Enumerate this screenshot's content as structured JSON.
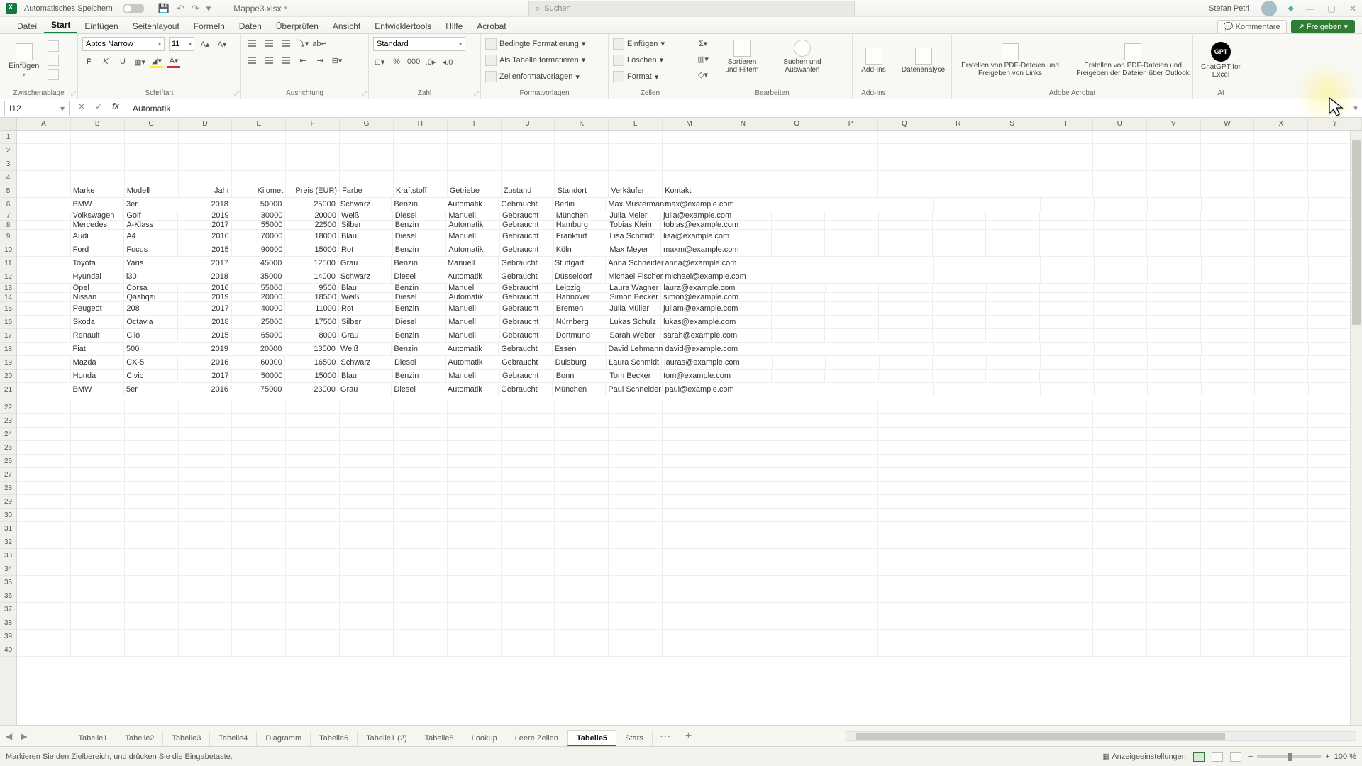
{
  "title": {
    "autosave": "Automatisches Speichern",
    "filename": "Mappe3.xlsx",
    "search_ph": "Suchen",
    "user": "Stefan Petri"
  },
  "ribbon_tabs": [
    "Datei",
    "Start",
    "Einfügen",
    "Seitenlayout",
    "Formeln",
    "Daten",
    "Überprüfen",
    "Ansicht",
    "Entwicklertools",
    "Hilfe",
    "Acrobat"
  ],
  "ribbon_right": {
    "kommentare": "Kommentare",
    "freigeben": "Freigeben"
  },
  "grp": {
    "einfuegen": "Einfügen",
    "zwischen": "Zwischenablage",
    "font": "Aptos Narrow",
    "size": "11",
    "schriftart": "Schriftart",
    "ausrichtung": "Ausrichtung",
    "numfmt": "Standard",
    "zahl": "Zahl",
    "bed": "Bedingte Formatierung",
    "als": "Als Tabelle formatieren",
    "zell": "Zellenformatvorlagen",
    "formatv": "Formatvorlagen",
    "ins": "Einfügen",
    "del": "Löschen",
    "fmt": "Format",
    "zellen": "Zellen",
    "sort": "Sortieren und Filtern",
    "such": "Suchen und Auswählen",
    "bearb": "Bearbeiten",
    "addins": "Add-Ins",
    "addins_g": "Add-Ins",
    "daten": "Datenanalyse",
    "pdf1": "Erstellen von PDF-Dateien und Freigeben von Links",
    "pdf2": "Erstellen von PDF-Dateien und Freigeben der Dateien über Outlook",
    "adobe": "Adobe Acrobat",
    "gpt": "ChatGPT for Excel",
    "ai": "AI"
  },
  "namebox": "I12",
  "formula": "Automatik",
  "cols": [
    "A",
    "B",
    "C",
    "D",
    "E",
    "F",
    "G",
    "H",
    "I",
    "J",
    "K",
    "L",
    "M",
    "N",
    "O",
    "P",
    "Q",
    "R",
    "S",
    "T",
    "U",
    "V",
    "W",
    "X",
    "Y"
  ],
  "row_layout": [
    {
      "n": "1"
    },
    {
      "n": "2"
    },
    {
      "n": "3"
    },
    {
      "n": "4"
    },
    {
      "n": "5",
      "d": 0
    },
    {
      "n": "6",
      "d": 1
    },
    {
      "n": "7",
      "d": 2,
      "squish": true
    },
    {
      "n": "8",
      "d": 3,
      "squish": true
    },
    {
      "n": "9",
      "d": 4
    },
    {
      "n": "10",
      "d": 5
    },
    {
      "n": "11",
      "d": 6
    },
    {
      "n": "12",
      "d": 7
    },
    {
      "n": "13",
      "d": 8,
      "squish": true
    },
    {
      "n": "14",
      "d": 9,
      "squish": true
    },
    {
      "n": "15",
      "d": 10
    },
    {
      "n": "16",
      "d": 11
    },
    {
      "n": "17",
      "d": 12
    },
    {
      "n": "18",
      "d": 13
    },
    {
      "n": "19",
      "d": 14
    },
    {
      "n": "20",
      "d": 15
    },
    {
      "n": "21",
      "d": 16,
      "gap": true
    },
    {
      "n": "22"
    },
    {
      "n": "23"
    },
    {
      "n": "24"
    },
    {
      "n": "25"
    },
    {
      "n": "26"
    },
    {
      "n": "27"
    },
    {
      "n": "28"
    },
    {
      "n": "29"
    },
    {
      "n": "30"
    },
    {
      "n": "31"
    },
    {
      "n": "32"
    },
    {
      "n": "33"
    },
    {
      "n": "34"
    },
    {
      "n": "35"
    },
    {
      "n": "36"
    },
    {
      "n": "37"
    },
    {
      "n": "38"
    },
    {
      "n": "39"
    },
    {
      "n": "40"
    }
  ],
  "data_rows": [
    [
      "Marke",
      "Modell",
      "Jahr",
      "Kilomet",
      "Preis (EUR)",
      "Farbe",
      "Kraftstoff",
      "Getriebe",
      "Zustand",
      "Standort",
      "Verkäufer",
      "Kontakt"
    ],
    [
      "BMW",
      "3er",
      "2018",
      "50000",
      "25000",
      "Schwarz",
      "Benzin",
      "Automatik",
      "Gebraucht",
      "Berlin",
      "Max Mustermann",
      "max@example.com"
    ],
    [
      "Volkswagen",
      "Golf",
      "2019",
      "30000",
      "20000",
      "Weiß",
      "Diesel",
      "Manuell",
      "Gebraucht",
      "München",
      "Julia Meier",
      "julia@example.com"
    ],
    [
      "Mercedes",
      "A-Klass",
      "2017",
      "55000",
      "22500",
      "Silber",
      "Benzin",
      "Automatik",
      "Gebraucht",
      "Hamburg",
      "Tobias Klein",
      "tobias@example.com"
    ],
    [
      "Audi",
      "A4",
      "2016",
      "70000",
      "18000",
      "Blau",
      "Diesel",
      "Manuell",
      "Gebraucht",
      "Frankfurt",
      "Lisa Schmidt",
      "lisa@example.com"
    ],
    [
      "Ford",
      "Focus",
      "2015",
      "90000",
      "15000",
      "Rot",
      "Benzin",
      "Automatik",
      "Gebraucht",
      "Köln",
      "Max Meyer",
      "maxm@example.com"
    ],
    [
      "Toyota",
      "Yaris",
      "2017",
      "45000",
      "12500",
      "Grau",
      "Benzin",
      "Manuell",
      "Gebraucht",
      "Stuttgart",
      "Anna Schneider",
      "anna@example.com"
    ],
    [
      "Hyundai",
      "i30",
      "2018",
      "35000",
      "14000",
      "Schwarz",
      "Diesel",
      "Automatik",
      "Gebraucht",
      "Düsseldorf",
      "Michael Fischer",
      "michael@example.com"
    ],
    [
      "Opel",
      "Corsa",
      "2016",
      "55000",
      "9500",
      "Blau",
      "Benzin",
      "Manuell",
      "Gebraucht",
      "Leipzig",
      "Laura Wagner",
      "laura@example.com"
    ],
    [
      "Nissan",
      "Qashqai",
      "2019",
      "20000",
      "18500",
      "Weiß",
      "Diesel",
      "Automatik",
      "Gebraucht",
      "Hannover",
      "Simon Becker",
      "simon@example.com"
    ],
    [
      "Peugeot",
      "208",
      "2017",
      "40000",
      "11000",
      "Rot",
      "Benzin",
      "Manuell",
      "Gebraucht",
      "Bremen",
      "Julia Müller",
      "juliam@example.com"
    ],
    [
      "Skoda",
      "Octavia",
      "2018",
      "25000",
      "17500",
      "Silber",
      "Diesel",
      "Manuell",
      "Gebraucht",
      "Nürnberg",
      "Lukas Schulz",
      "lukas@example.com"
    ],
    [
      "Renault",
      "Clio",
      "2015",
      "65000",
      "8000",
      "Grau",
      "Benzin",
      "Manuell",
      "Gebraucht",
      "Dortmund",
      "Sarah Weber",
      "sarah@example.com"
    ],
    [
      "Fiat",
      "500",
      "2019",
      "20000",
      "13500",
      "Weiß",
      "Benzin",
      "Automatik",
      "Gebraucht",
      "Essen",
      "David Lehmann",
      "david@example.com"
    ],
    [
      "Mazda",
      "CX-5",
      "2016",
      "60000",
      "16500",
      "Schwarz",
      "Diesel",
      "Automatik",
      "Gebraucht",
      "Duisburg",
      "Laura Schmidt",
      "lauras@example.com"
    ],
    [
      "Honda",
      "Civic",
      "2017",
      "50000",
      "15000",
      "Blau",
      "Benzin",
      "Manuell",
      "Gebraucht",
      "Bonn",
      "Tom Becker",
      "tom@example.com"
    ],
    [
      "BMW",
      "5er",
      "2016",
      "75000",
      "23000",
      "Grau",
      "Diesel",
      "Automatik",
      "Gebraucht",
      "München",
      "Paul Schneider",
      "paul@example.com"
    ]
  ],
  "sheet_tabs": [
    "Tabelle1",
    "Tabelle2",
    "Tabelle3",
    "Tabelle4",
    "Diagramm",
    "Tabelle6",
    "Tabelle1 (2)",
    "Tabelle8",
    "Lookup",
    "Leere Zeilen",
    "Tabelle5",
    "Stars"
  ],
  "active_sheet": 10,
  "status": {
    "msg": "Markieren Sie den Zielbereich, und drücken Sie die Eingabetaste.",
    "anz": "Anzeigeeinstellungen",
    "zoom": "100 %"
  }
}
